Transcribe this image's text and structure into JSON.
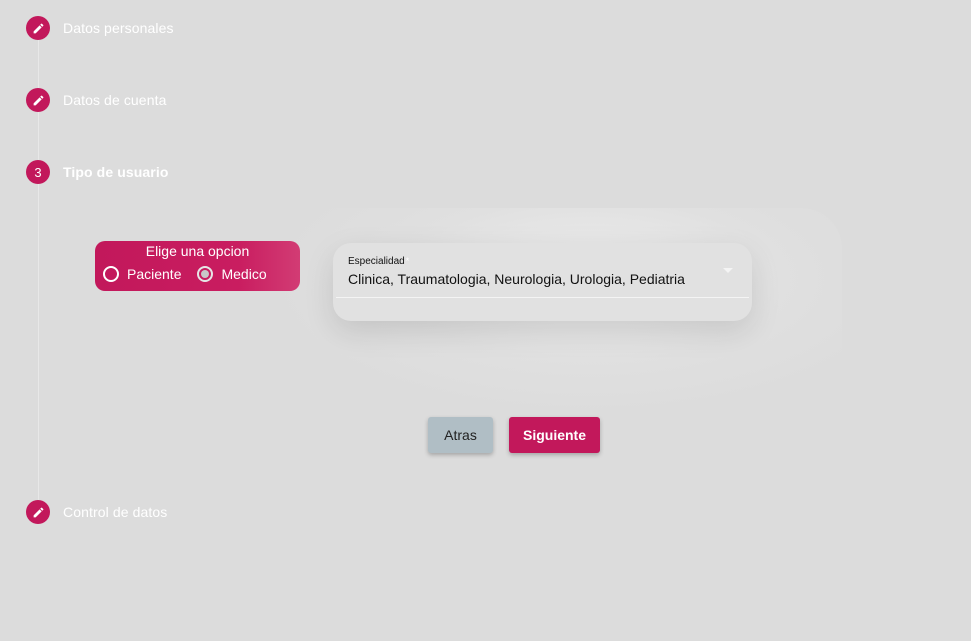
{
  "stepper": {
    "steps": [
      {
        "label": "Datos personales",
        "indicator": "pencil-icon"
      },
      {
        "label": "Datos de cuenta",
        "indicator": "pencil-icon"
      },
      {
        "label": "Tipo de usuario",
        "number": "3",
        "active": true
      },
      {
        "label": "Control de datos",
        "indicator": "pencil-icon"
      }
    ]
  },
  "user_type": {
    "title": "Elige una opcion",
    "options": [
      {
        "label": "Paciente",
        "selected": false
      },
      {
        "label": "Medico",
        "selected": true
      }
    ]
  },
  "speciality": {
    "label": "Especialidad",
    "required_mark": "*",
    "value": "Clinica, Traumatologia, Neurologia, Urologia, Pediatria"
  },
  "actions": {
    "back_label": "Atras",
    "next_label": "Siguiente"
  },
  "colors": {
    "accent": "#c2185b",
    "back_button": "#b0bec5",
    "background": "#dcdcdc"
  }
}
